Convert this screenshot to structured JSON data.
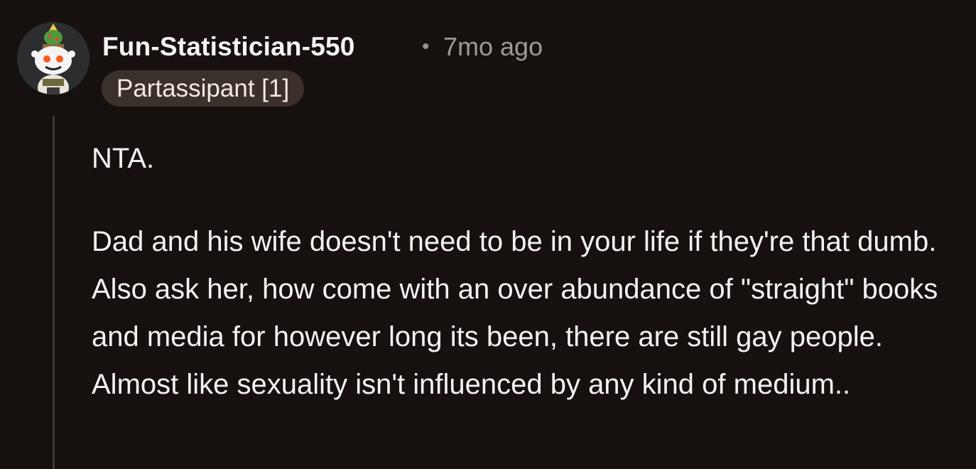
{
  "comment": {
    "author": "Fun-Statistician-550",
    "separator": "•",
    "time_ago": "7mo ago",
    "flair": "Partassipant [1]",
    "avatar_icon": "snoo-avatar-icon",
    "paragraphs": [
      "NTA.",
      "Dad and his wife doesn't need to be in your life if they're that dumb. Also ask her, how come with an over abundance of \"straight\" books and media for however long its been, there are still gay people. Almost like sexuality isn't influenced by any kind of medium.."
    ]
  },
  "colors": {
    "background": "#16110f",
    "flair_background": "#3c302a",
    "muted_text": "#a29892",
    "thread_line": "#3d3936"
  }
}
